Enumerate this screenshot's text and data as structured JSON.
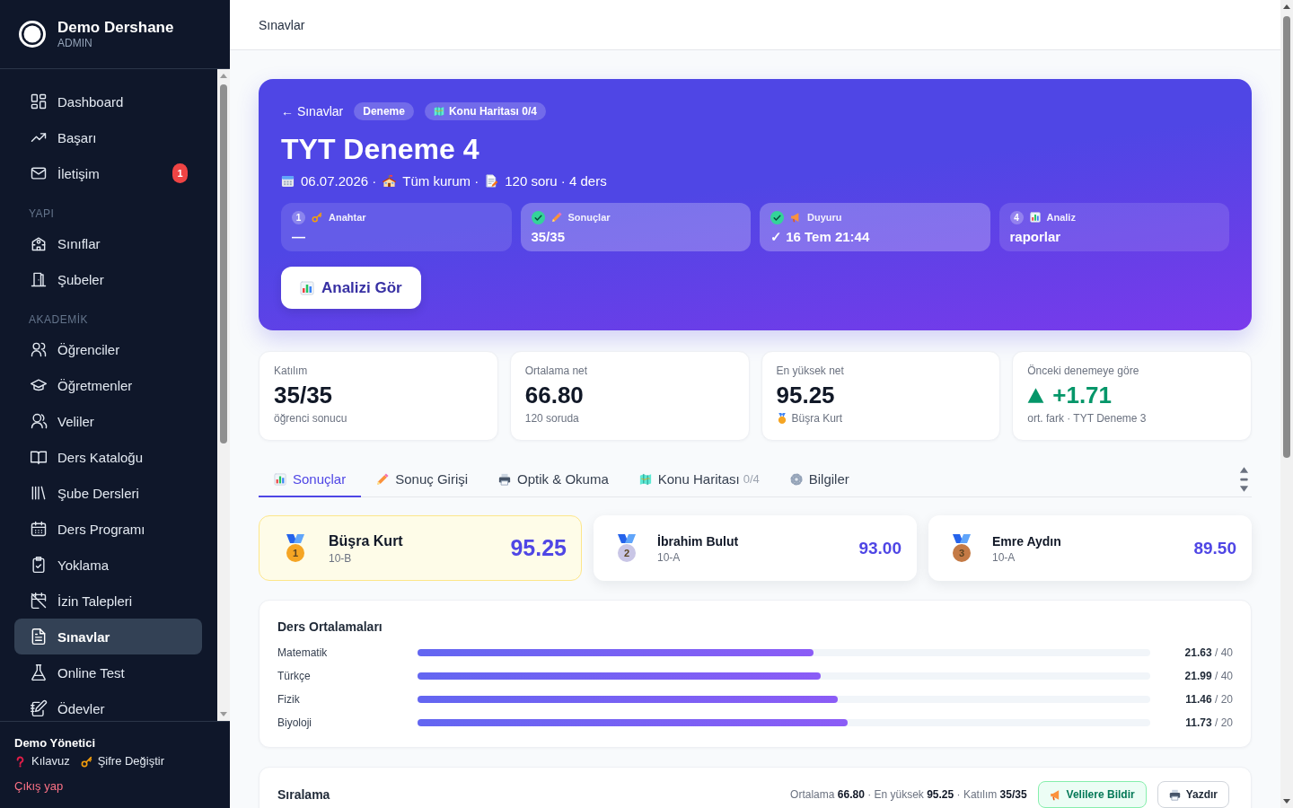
{
  "sidebar": {
    "brand": {
      "name": "Demo Dershane",
      "role": "ADMIN"
    },
    "sections": [
      {
        "items": [
          {
            "label": "Dashboard",
            "kind": "grid",
            "selected": false
          },
          {
            "label": "Başarı",
            "kind": "trend",
            "selected": false
          },
          {
            "label": "İletişim",
            "kind": "mail",
            "selected": false,
            "badge": "1"
          }
        ]
      },
      {
        "title": "YAPI",
        "items": [
          {
            "label": "Sınıflar",
            "kind": "school",
            "selected": false
          },
          {
            "label": "Şubeler",
            "kind": "door",
            "selected": false
          }
        ]
      },
      {
        "title": "AKADEMİK",
        "items": [
          {
            "label": "Öğrenciler",
            "kind": "users",
            "selected": false
          },
          {
            "label": "Öğretmenler",
            "kind": "cap",
            "selected": false
          },
          {
            "label": "Veliler",
            "kind": "parents",
            "selected": false
          },
          {
            "label": "Ders Kataloğu",
            "kind": "book",
            "selected": false
          },
          {
            "label": "Şube Dersleri",
            "kind": "shelf",
            "selected": false
          },
          {
            "label": "Ders Programı",
            "kind": "calendar",
            "selected": false
          },
          {
            "label": "Yoklama",
            "kind": "clipboard",
            "selected": false
          },
          {
            "label": "İzin Talepleri",
            "kind": "leave",
            "selected": false
          },
          {
            "label": "Sınavlar",
            "kind": "file",
            "selected": true
          },
          {
            "label": "Online Test",
            "kind": "flask",
            "selected": false
          },
          {
            "label": "Ödevler",
            "kind": "notebook",
            "selected": false
          }
        ]
      }
    ],
    "user": {
      "name": "Demo Yönetici",
      "links": [
        {
          "label": "Kılavuz",
          "kind": "help"
        },
        {
          "label": "Şifre Değiştir",
          "kind": "key"
        }
      ],
      "logout": "Çıkış yap"
    }
  },
  "topbar": {
    "title": "Sınavlar"
  },
  "hero": {
    "back": "← Sınavlar",
    "tags": [
      {
        "label": "Deneme",
        "kind": "plain"
      },
      {
        "label": "Konu Haritası 0/4",
        "kind": "map"
      }
    ],
    "title": "TYT Deneme 4",
    "meta": [
      {
        "kind": "calendar",
        "text": "06.07.2026 ·"
      },
      {
        "kind": "school",
        "text": "Tüm kurum ·"
      },
      {
        "kind": "memo",
        "text": "120 soru · 4 ders"
      }
    ],
    "steps": [
      {
        "badge": "1",
        "done": false,
        "kind": "key",
        "label": "Anahtar",
        "value": "—"
      },
      {
        "done": true,
        "kind": "pencil",
        "label": "Sonuçlar",
        "value": "35/35"
      },
      {
        "done": true,
        "kind": "megaphone",
        "label": "Duyuru",
        "value": "✓ 16 Tem 21:44"
      },
      {
        "badge": "4",
        "done": false,
        "kind": "chart",
        "label": "Analiz",
        "value": "raporlar"
      }
    ],
    "action": {
      "label": "Analizi Gör",
      "kind": "chart"
    }
  },
  "stats": [
    {
      "kind": "plain",
      "label": "Katılım",
      "value": "35/35",
      "note": "öğrenci sonucu"
    },
    {
      "kind": "plain",
      "label": "Ortalama net",
      "value": "66.80",
      "note": "120 soruda"
    },
    {
      "kind": "medal",
      "label": "En yüksek net",
      "value": "95.25",
      "note": "Büşra Kurt"
    },
    {
      "kind": "delta",
      "rising": true,
      "label": "Önceki denemeye göre",
      "value": "+1.71",
      "note": "ort. fark · TYT Deneme 3"
    }
  ],
  "tabs": [
    {
      "label": "Sonuçlar",
      "kind": "chart",
      "selected": true
    },
    {
      "label": "Sonuç Girişi",
      "kind": "pencil",
      "selected": false
    },
    {
      "label": "Optik & Okuma",
      "kind": "printer",
      "selected": false
    },
    {
      "label": "Konu Haritası",
      "count": "0/4",
      "kind": "map",
      "selected": false
    },
    {
      "label": "Bilgiler",
      "kind": "gear",
      "selected": false
    }
  ],
  "podium": [
    {
      "rank": "1",
      "name": "Büşra Kurt",
      "class": "10-B",
      "score": "95.25",
      "color": "#f5a524",
      "highlighted": true
    },
    {
      "rank": "2",
      "name": "İbrahim Bulut",
      "class": "10-A",
      "score": "93.00",
      "color": "#c9c6e6",
      "highlighted": false
    },
    {
      "rank": "3",
      "name": "Emre Aydın",
      "class": "10-A",
      "score": "89.50",
      "color": "#c47a45",
      "highlighted": false
    }
  ],
  "averages": {
    "title": "Ders Ortalamaları",
    "rows": [
      {
        "subject": "Matematik",
        "level": 0.541,
        "score": "21.63",
        "max": "/ 40"
      },
      {
        "subject": "Türkçe",
        "level": 0.55,
        "score": "21.99",
        "max": "/ 40"
      },
      {
        "subject": "Fizik",
        "level": 0.573,
        "score": "11.46",
        "max": "/ 20"
      },
      {
        "subject": "Biyoloji",
        "level": 0.587,
        "score": "11.73",
        "max": "/ 20"
      }
    ]
  },
  "ranking": {
    "title": "Sıralama",
    "summary": "Ortalama **66.80** · En yüksek **95.25** · Katılım **35/35**",
    "buttons": [
      {
        "label": "Velilere Bildir",
        "kind": "notify"
      },
      {
        "label": "Yazdır",
        "kind": "print"
      }
    ]
  }
}
